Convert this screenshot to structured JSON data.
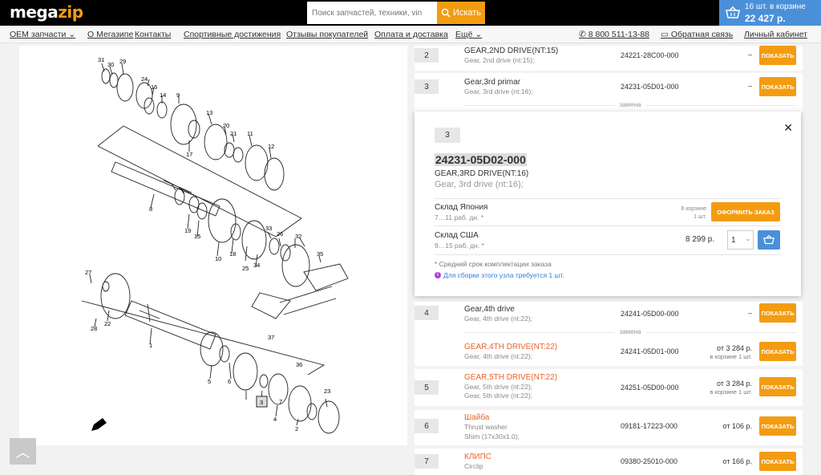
{
  "header": {
    "logo_part1": "mega",
    "logo_part2": "zip",
    "search_placeholder": "Поиск запчастей, техники, vin",
    "search_button": "Искать",
    "cart_count": "16 шт. в корзине",
    "cart_total": "22 427 р.",
    "colors": {
      "accent": "#f39c12",
      "cart_blue": "#4a90d9",
      "topbar": "#000000"
    }
  },
  "nav": {
    "items": [
      "OEM запчасти",
      "О Мегазипе",
      "Контакты",
      "Спортивные достижения",
      "Отзывы покупателей",
      "Оплата и доставка",
      "Ещё"
    ],
    "phone": "8 800 511-13-88",
    "feedback": "Обратная связь",
    "account": "Личный кабинет"
  },
  "diagram": {
    "labels": [
      "31",
      "30",
      "29",
      "24",
      "16",
      "14",
      "9",
      "13",
      "17",
      "20",
      "21",
      "11",
      "12",
      "8",
      "19",
      "15",
      "10",
      "18",
      "25",
      "34",
      "33",
      "26",
      "32",
      "35",
      "27",
      "22",
      "28",
      "1",
      "5",
      "6",
      "3",
      "7",
      "4",
      "2",
      "23",
      "36",
      "37"
    ],
    "selected_label": "3"
  },
  "parts": [
    {
      "pos": "2",
      "name": "GEAR,2ND DRIVE(NT:15)",
      "sub": "Gear, 2nd drive (nt:15);",
      "number": "24221-28C00-000",
      "price": "–",
      "button": "ПОКАЗАТЬ"
    },
    {
      "pos": "3",
      "name": "Gear,3rd primar",
      "sub": "Gear, 3rd drive (nt:16);",
      "number": "24231-05D01-000",
      "price": "–",
      "button": "ПОКАЗАТЬ"
    },
    {
      "pos": "4",
      "name": "Gear,4th drive",
      "sub": "Gear, 4th drive (nt:22);",
      "number": "24241-05D00-000",
      "price": "–",
      "button": "ПОКАЗАТЬ"
    },
    {
      "name": "GEAR,4TH DRIVE(NT:22)",
      "sub": "Gear, 4th drive (nt:22);",
      "number": "24241-05D01-000",
      "price": "от 3 284 р.",
      "price_sub": "в корзине 1 шт.",
      "button": "ПОКАЗАТЬ"
    },
    {
      "pos": "5",
      "name": "GEAR,5TH DRIVE(NT:22)",
      "sub": "Gear, 5th drive (nt:22);",
      "sub2": "Gear, 5th drive (nt:22);",
      "number": "24251-05D00-000",
      "price": "от 3 284 р.",
      "price_sub": "в корзине 1 шт.",
      "button": "ПОКАЗАТЬ"
    },
    {
      "pos": "6",
      "name": "Шайба",
      "sub": "Thrust washer",
      "sub2": "Shim (17x30x1.0);",
      "number": "09181-17223-000",
      "price": "от 106 р.",
      "button": "ПОКАЗАТЬ"
    },
    {
      "pos": "7",
      "name": "КЛИПС",
      "sub": "Circlip",
      "number": "09380-25010-000",
      "price": "от 166 р.",
      "button": "ПОКАЗАТЬ"
    }
  ],
  "replacement_label": "замена",
  "popup": {
    "pos": "3",
    "number": "24231-05D02-000",
    "name": "GEAR,3RD DRIVE(NT:16)",
    "desc": "Gear, 3rd drive (nt:16);",
    "warehouses": [
      {
        "name": "Склад Япония",
        "term": "7…11 раб. дн. *",
        "in_cart": "8 корзине",
        "in_cart2": "1 шт.",
        "button": "ОФОРМИТЬ ЗАКАЗ"
      },
      {
        "name": "Склад США",
        "term": "9…15 раб. дн. *",
        "price": "8 299 р.",
        "qty": "1"
      }
    ],
    "note": "* Средний срок комплектации заказа",
    "info": "Для сборки этого узла требуется 1 шт."
  }
}
